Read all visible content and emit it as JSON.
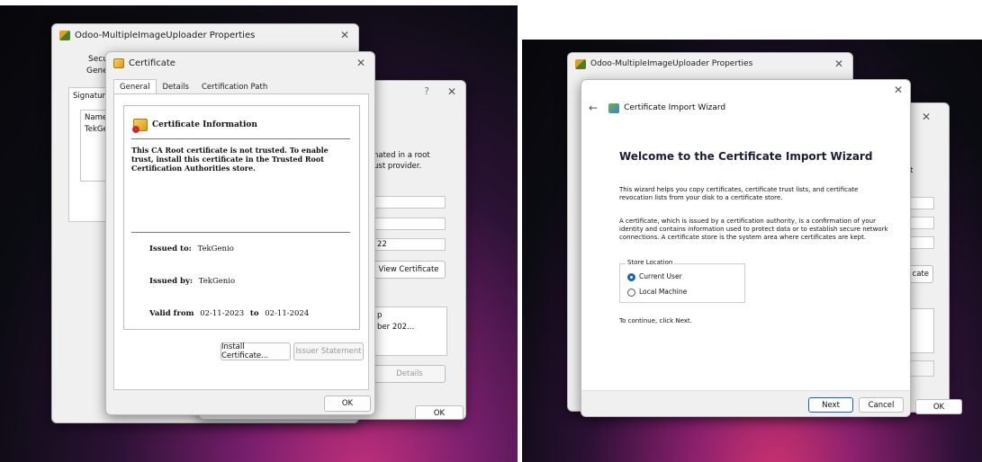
{
  "left": {
    "props_window": {
      "title": "Odoo-MultipleImageUploader Properties",
      "tab_partial_1": "Secu",
      "tab_partial_2": "Gener",
      "group_label_partial": "Signature",
      "list_header_partial": "Name",
      "list_row_partial": "TekGe"
    },
    "sig_details_window": {
      "text_partial_1": "nated in a root",
      "text_partial_2": "ust provider.",
      "field_partial": "22",
      "view_certificate_label": "View Certificate",
      "box_partial_1": "p",
      "box_partial_2": "ber 202...",
      "details_label": "Details",
      "ok_label": "OK"
    },
    "certificate_window": {
      "title": "Certificate",
      "tabs": [
        "General",
        "Details",
        "Certification Path"
      ],
      "info_heading": "Certificate Information",
      "warning": "This CA Root certificate is not trusted. To enable trust, install this certificate in the Trusted Root Certification Authorities store.",
      "issued_to_label": "Issued to:",
      "issued_to_value": "TekGenio",
      "issued_by_label": "Issued by:",
      "issued_by_value": "TekGenio",
      "valid_from_label": "Valid from",
      "valid_from_value": "02-11-2023",
      "valid_to_label": "to",
      "valid_to_value": "02-11-2024",
      "install_label": "Install Certificate...",
      "issuer_statement_label": "Issuer Statement",
      "ok_label": "OK"
    }
  },
  "right": {
    "props_window": {
      "title": "Odoo-MultipleImageUploader Properties",
      "partial_t": "t",
      "partial_cate": "cate",
      "ok_label": "OK"
    },
    "wizard": {
      "back_icon": "back-arrow-icon",
      "title": "Certificate Import Wizard",
      "heading": "Welcome to the Certificate Import Wizard",
      "para1": "This wizard helps you copy certificates, certificate trust lists, and certificate revocation lists from your disk to a certificate store.",
      "para2": "A certificate, which is issued by a certification authority, is a confirmation of your identity and contains information used to protect data or to establish secure network connections. A certificate store is the system area where certificates are kept.",
      "store_location_label": "Store Location",
      "options": [
        "Current User",
        "Local Machine"
      ],
      "selected": "Current User",
      "continue_text": "To continue, click Next.",
      "next_label": "Next",
      "cancel_label": "Cancel"
    }
  }
}
